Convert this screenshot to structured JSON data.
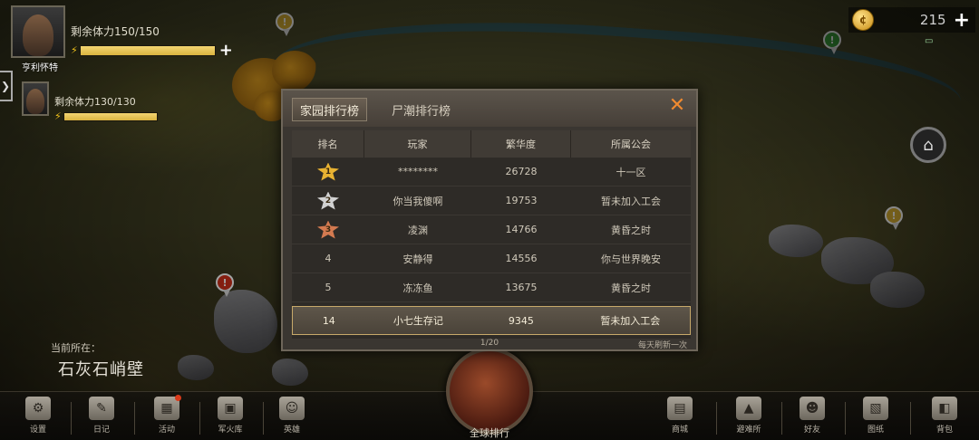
{
  "characters": [
    {
      "stamina": "剩余体力150/150",
      "name": "亨利怀特",
      "fill": 1.0
    },
    {
      "stamina": "剩余体力130/130",
      "name": "",
      "fill": 1.0
    }
  ],
  "currency": {
    "amount": "215",
    "icon": "coin-icon"
  },
  "location": {
    "caption": "当前所在：",
    "name": "石灰石峭壁"
  },
  "leaderboard": {
    "tabs": [
      "家园排行榜",
      "尸潮排行榜"
    ],
    "active_tab": 0,
    "columns": [
      "排名",
      "玩家",
      "繁华度",
      "所属公会"
    ],
    "rows": [
      {
        "rank": "1",
        "medal": "gold",
        "player": "********",
        "prosperity": "26728",
        "guild": "十一区"
      },
      {
        "rank": "2",
        "medal": "silver",
        "player": "你当我傻啊",
        "prosperity": "19753",
        "guild": "暂未加入工会"
      },
      {
        "rank": "3",
        "medal": "bronze",
        "player": "凌渊",
        "prosperity": "14766",
        "guild": "黄昏之时"
      },
      {
        "rank": "4",
        "medal": "",
        "player": "安静得",
        "prosperity": "14556",
        "guild": "你与世界晚安"
      },
      {
        "rank": "5",
        "medal": "",
        "player": "冻冻鱼",
        "prosperity": "13675",
        "guild": "黄昏之时"
      }
    ],
    "my_row": {
      "rank": "14",
      "player": "小七生存记",
      "prosperity": "9345",
      "guild": "暂未加入工会"
    },
    "page": "1/20",
    "refresh_note": "每天刷新一次",
    "close_icon": "close-icon"
  },
  "bottom_nav": {
    "left": [
      {
        "label": "设置",
        "icon": "gear-icon",
        "glyph": "⚙"
      },
      {
        "label": "日记",
        "icon": "diary-icon",
        "glyph": "✎"
      },
      {
        "label": "活动",
        "icon": "calendar-icon",
        "glyph": "▦",
        "badge": true
      },
      {
        "label": "军火库",
        "icon": "crate-icon",
        "glyph": "▣"
      },
      {
        "label": "英雄",
        "icon": "heroes-icon",
        "glyph": "☺"
      }
    ],
    "center": {
      "label": "全球排行",
      "icon": "globe-icon"
    },
    "right": [
      {
        "label": "商城",
        "icon": "shop-icon",
        "glyph": "▤"
      },
      {
        "label": "避难所",
        "icon": "shelter-icon",
        "glyph": "▲"
      },
      {
        "label": "好友",
        "icon": "friends-icon",
        "glyph": "☻"
      },
      {
        "label": "图纸",
        "icon": "blueprint-icon",
        "glyph": "▧"
      },
      {
        "label": "背包",
        "icon": "backpack-icon",
        "glyph": "◧"
      }
    ]
  }
}
